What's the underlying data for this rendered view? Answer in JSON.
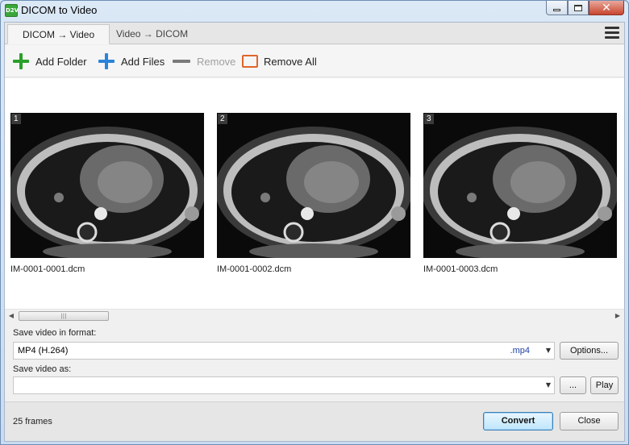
{
  "window": {
    "title": "DICOM to Video",
    "icon_text": "D2V"
  },
  "tabs": [
    {
      "label": "DICOM → Video",
      "active": true
    },
    {
      "label": "Video → DICOM",
      "active": false
    }
  ],
  "toolbar": {
    "add_folder": "Add Folder",
    "add_files": "Add Files",
    "remove": "Remove",
    "remove_all": "Remove All"
  },
  "thumbnails": [
    {
      "index": "1",
      "filename": "IM-0001-0001.dcm"
    },
    {
      "index": "2",
      "filename": "IM-0001-0002.dcm"
    },
    {
      "index": "3",
      "filename": "IM-0001-0003.dcm"
    }
  ],
  "format": {
    "label": "Save video in format:",
    "value": "MP4 (H.264)",
    "extension": ".mp4",
    "options_button": "Options..."
  },
  "save_as": {
    "label": "Save video as:",
    "value": "",
    "browse_button": "...",
    "play_button": "Play"
  },
  "status": {
    "frames": "25 frames"
  },
  "actions": {
    "convert": "Convert",
    "close": "Close"
  },
  "colors": {
    "accent_green": "#2aa02a",
    "accent_blue": "#2b83d9",
    "remove_all_orange": "#e0652a",
    "extension_blue": "#1e3fa6"
  }
}
